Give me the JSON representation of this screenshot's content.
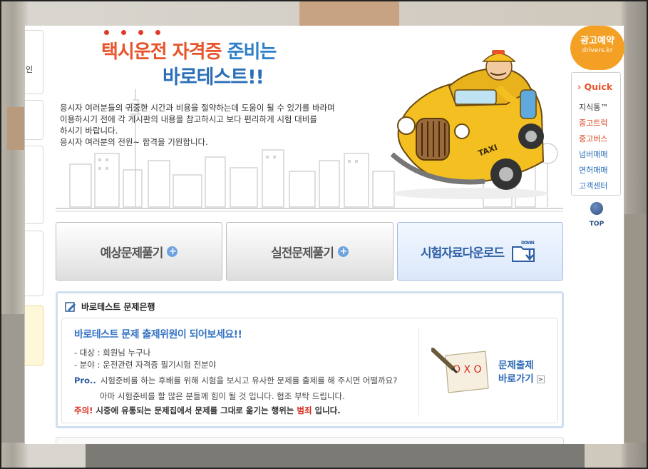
{
  "header": {
    "title_part1": "택시운전 자격증",
    "title_part2": "준비는",
    "title_line2": "바로테스트!!"
  },
  "intro": {
    "lines": [
      "응시자 여러분들의 귀중한 시간과 비용을 절약하는데 도움이 될 수 있기를 바라며",
      "이용하시기  전에 각 게시판의 내용을 참고하시고 보다 편리하게 시험 대비를",
      "하시기 바랍니다.",
      "응시자 여러분의 전원~ 합격을 기원합니다."
    ]
  },
  "left_tabs": {
    "item0": "인"
  },
  "illustration": {
    "taxi_sign": "TAXI"
  },
  "tabs": [
    {
      "label": "예상문제풀기",
      "icon": "plus-circle-icon"
    },
    {
      "label": "실전문제풀기",
      "icon": "plus-circle-icon"
    },
    {
      "label": "시험자료다운로드",
      "icon": "folder-download-icon",
      "icon_text": "DOWN"
    }
  ],
  "bank": {
    "title": "바로테스트 문제은행",
    "invite": "바로테스트 문제 출제위원이 되어보세요!!",
    "target_label": "- 대상 : 회원님 누구나",
    "field_label": "- 분야 : 운전관련 자격증 필기시험 전분야",
    "pro_tag": "Pro..",
    "pro_line1": "시험준비를 하는 후배를 위해 시험을 보시고 유사한 문제를 출제를 해 주시면 어떨까요?",
    "pro_line2": "아마 시험준비를 할 많은 분들께 힘이 될 것 입니다. 협조 부탁 드립니다.",
    "warn_prefix": "주의!",
    "warn_text": " 시중에 유통되는 문제집에서 문제를 그대로 옮기는 행위는 ",
    "warn_emph": "범죄",
    "warn_suffix": " 입니다.",
    "goto_line1": "문제출제",
    "goto_line2": "바로가기",
    "paper_marks": "O X O"
  },
  "sidebar": {
    "ad_title": "광고예약",
    "ad_domain": "drivers.kr",
    "quick_title": "Quick",
    "items": [
      {
        "label": "지식통™",
        "color": "#333333"
      },
      {
        "label": "중고트럭",
        "color": "#d9431c"
      },
      {
        "label": "중고버스",
        "color": "#d9431c"
      },
      {
        "label": "넘버매매",
        "color": "#2c6fb8"
      },
      {
        "label": "면허매매",
        "color": "#2c6fb8"
      },
      {
        "label": "고객센터",
        "color": "#2c6fb8"
      }
    ],
    "top_label": "TOP"
  }
}
